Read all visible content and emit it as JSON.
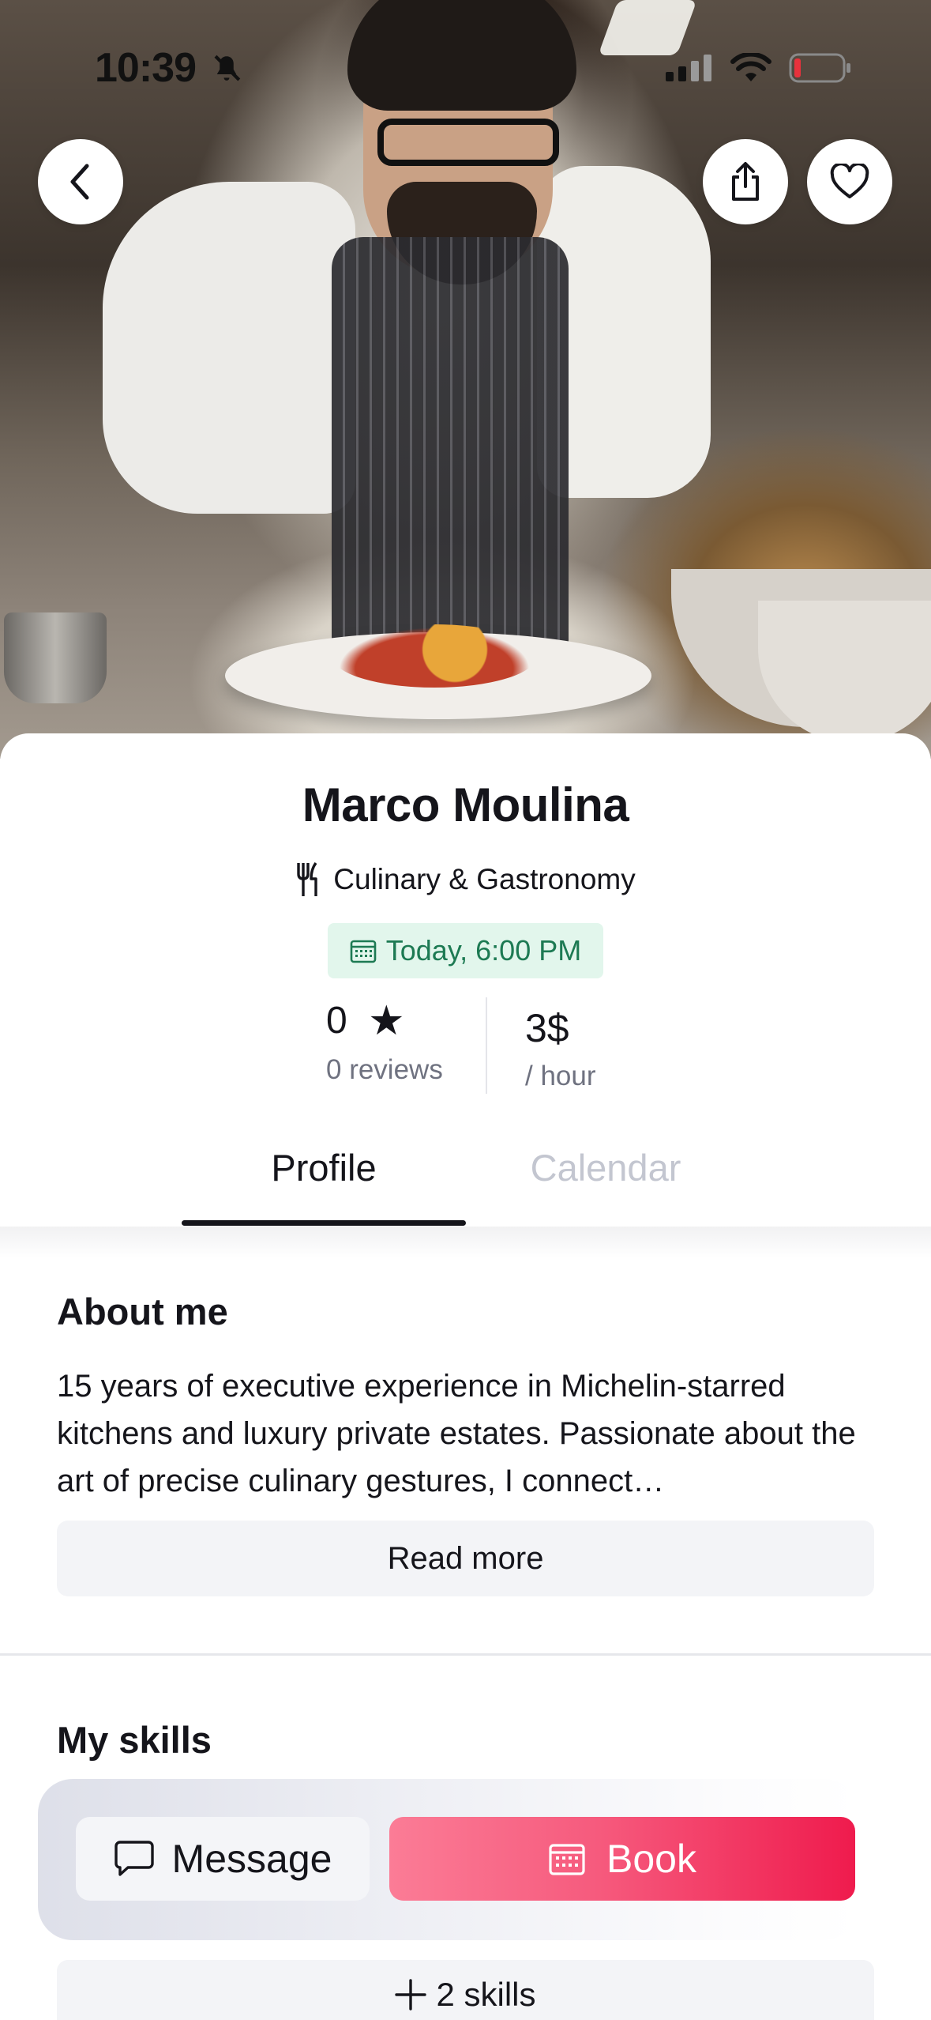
{
  "status_bar": {
    "time": "10:39"
  },
  "chef": {
    "name": "Marco Moulina",
    "category": "Culinary & Gastronomy",
    "availability": "Today, 6:00 PM",
    "rating": "0",
    "reviews_label": "0 reviews",
    "price": "3$",
    "price_unit": "/ hour"
  },
  "tabs": [
    {
      "label": "Profile",
      "active": true
    },
    {
      "label": "Calendar",
      "active": false
    }
  ],
  "about": {
    "title": "About me",
    "text": "15 years of executive experience in Michelin-starred kitchens and luxury private estates. Passionate about the art of precise culinary gestures, I connect…",
    "read_more_label": "Read more"
  },
  "skills": {
    "title": "My skills",
    "more_label": "2 skills"
  },
  "actions": {
    "message_label": "Message",
    "book_label": "Book"
  },
  "colors": {
    "accent_gradient_start": "#fb7c96",
    "accent_gradient_end": "#ef1b4d",
    "availability_bg": "#e2f6ec",
    "availability_text": "#1d7a53"
  },
  "icons": [
    "back-chevron-icon",
    "share-icon",
    "heart-icon",
    "utensils-icon",
    "calendar-icon",
    "star-icon",
    "chat-bubble-icon",
    "plus-icon",
    "bell-slash-icon",
    "signal-icon",
    "wifi-icon",
    "battery-icon"
  ]
}
